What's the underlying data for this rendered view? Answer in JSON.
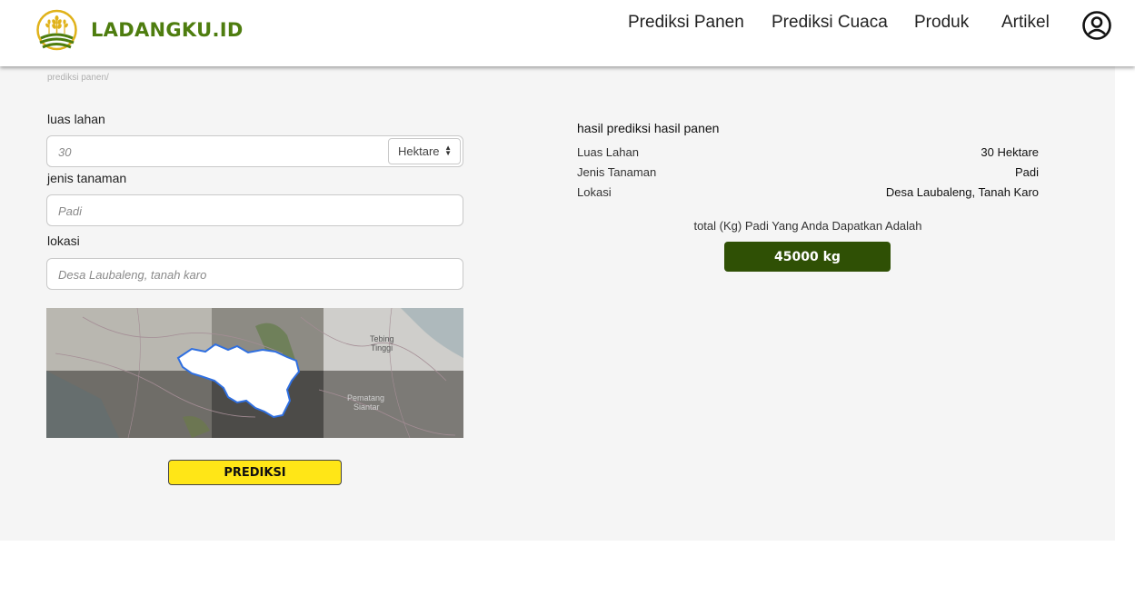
{
  "brand": {
    "name": "LADANGKU.ID",
    "color": "#4e7d0f",
    "icon": "wheat-logo-icon"
  },
  "nav": {
    "items": [
      {
        "label": "Prediksi Panen"
      },
      {
        "label": "Prediksi Cuaca"
      },
      {
        "label": "Produk"
      },
      {
        "label": "Artikel"
      }
    ],
    "user_icon": "user-circle-icon"
  },
  "breadcrumb": "prediksi panen/",
  "form": {
    "luas_label": "luas lahan",
    "luas_placeholder": "30",
    "unit_selected": "Hektare",
    "jenis_label": "jenis tanaman",
    "jenis_placeholder": "Padi",
    "lokasi_label": "lokasi",
    "lokasi_placeholder": "Desa Laubaleng, tanah karo",
    "map_places": {
      "city1": "Tebing",
      "city1b": "Tinggi",
      "city2": "Pematang",
      "city2b": "Siantar"
    },
    "submit_label": "PREDIKSI",
    "submit_color": "#ffe617"
  },
  "result": {
    "title": "hasil prediksi hasil panen",
    "rows": [
      {
        "key": "Luas Lahan",
        "value": "30 Hektare"
      },
      {
        "key": "Jenis Tanaman",
        "value": "Padi"
      },
      {
        "key": "Lokasi",
        "value": "Desa Laubaleng, Tanah Karo"
      }
    ],
    "total_text": "total (Kg) Padi Yang Anda Dapatkan Adalah",
    "total_value": "45000 kg",
    "total_color": "#2f5005"
  }
}
